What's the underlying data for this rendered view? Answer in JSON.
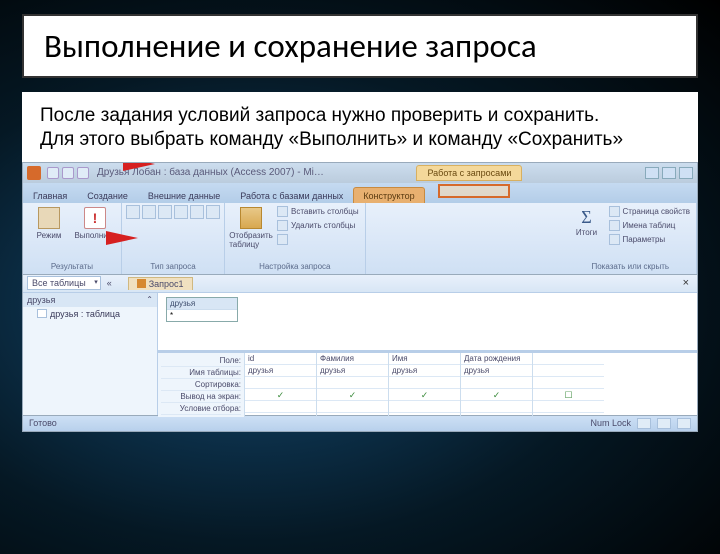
{
  "title": "Выполнение и сохранение запроса",
  "body": "После задания условий запроса нужно проверить и сохранить.\nДля этого выбрать команду «Выполнить» и команду «Сохранить»",
  "app": {
    "titlebar": "Друзья Лобан : база данных (Access 2007) - Mi…",
    "context_group": "Работа с запросами",
    "tabs": [
      "Главная",
      "Создание",
      "Внешние данные",
      "Работа с базами данных",
      "Конструктор"
    ],
    "active_tab": 4,
    "ribbon": {
      "results": {
        "label": "Результаты",
        "view": "Режим",
        "run": "Выполнить"
      },
      "qtype": {
        "label": "Тип запроса"
      },
      "setup": {
        "label": "Настройка запроса",
        "show_table": "Отобразить таблицу",
        "insert_col": "Вставить столбцы",
        "delete_col": "Удалить столбцы"
      },
      "showhide": {
        "label": "Показать или скрыть",
        "totals": "Итоги",
        "prop": "Страница свойств",
        "names": "Имена таблиц",
        "params": "Параметры"
      }
    },
    "nav": {
      "all_tables": "Все таблицы",
      "collapse": "«",
      "group": "друзья",
      "item": "друзья : таблица",
      "query_tab": "Запрос1"
    },
    "design_table": {
      "name": "друзья"
    },
    "grid": {
      "rows": [
        "Поле:",
        "Имя таблицы:",
        "Сортировка:",
        "Вывод на экран:",
        "Условие отбора:"
      ],
      "cols": [
        {
          "field": "id",
          "table": "друзья",
          "show": "✓"
        },
        {
          "field": "Фамилия",
          "table": "друзья",
          "show": "✓"
        },
        {
          "field": "Имя",
          "table": "друзья",
          "show": "✓"
        },
        {
          "field": "Дата рождения",
          "table": "друзья",
          "show": "✓"
        }
      ]
    },
    "status": {
      "left": "Готово",
      "numlock": "Num Lock"
    }
  }
}
